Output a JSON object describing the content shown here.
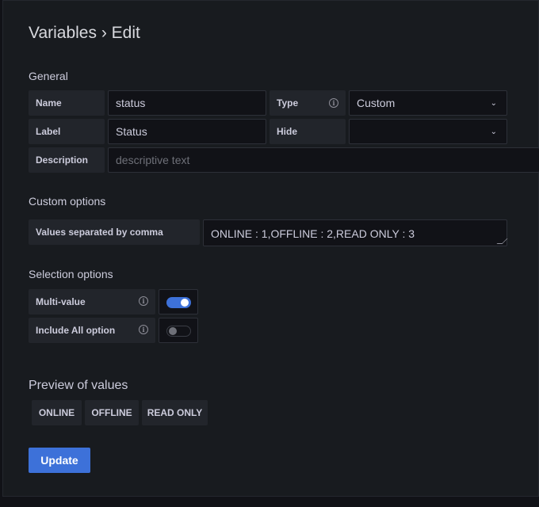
{
  "header": {
    "title": "Variables › Edit"
  },
  "general": {
    "section_title": "General",
    "name": {
      "label": "Name",
      "value": "status"
    },
    "type": {
      "label": "Type",
      "value": "Custom"
    },
    "label": {
      "label": "Label",
      "value": "Status"
    },
    "hide": {
      "label": "Hide",
      "value": ""
    },
    "description": {
      "label": "Description",
      "placeholder": "descriptive text"
    }
  },
  "custom_options": {
    "section_title": "Custom options",
    "values_label": "Values separated by comma",
    "values": "ONLINE : 1,OFFLINE : 2,READ ONLY : 3"
  },
  "selection_options": {
    "section_title": "Selection options",
    "multi_value": {
      "label": "Multi-value",
      "enabled": true
    },
    "include_all": {
      "label": "Include All option",
      "enabled": false
    }
  },
  "preview": {
    "title": "Preview of values",
    "values": [
      "ONLINE",
      "OFFLINE",
      "READ ONLY"
    ]
  },
  "actions": {
    "update_label": "Update"
  },
  "icons": {
    "info": "info-circle-icon",
    "chevron": "chevron-down-icon"
  },
  "colors": {
    "accent": "#3d71d9",
    "background": "#181b1f"
  }
}
